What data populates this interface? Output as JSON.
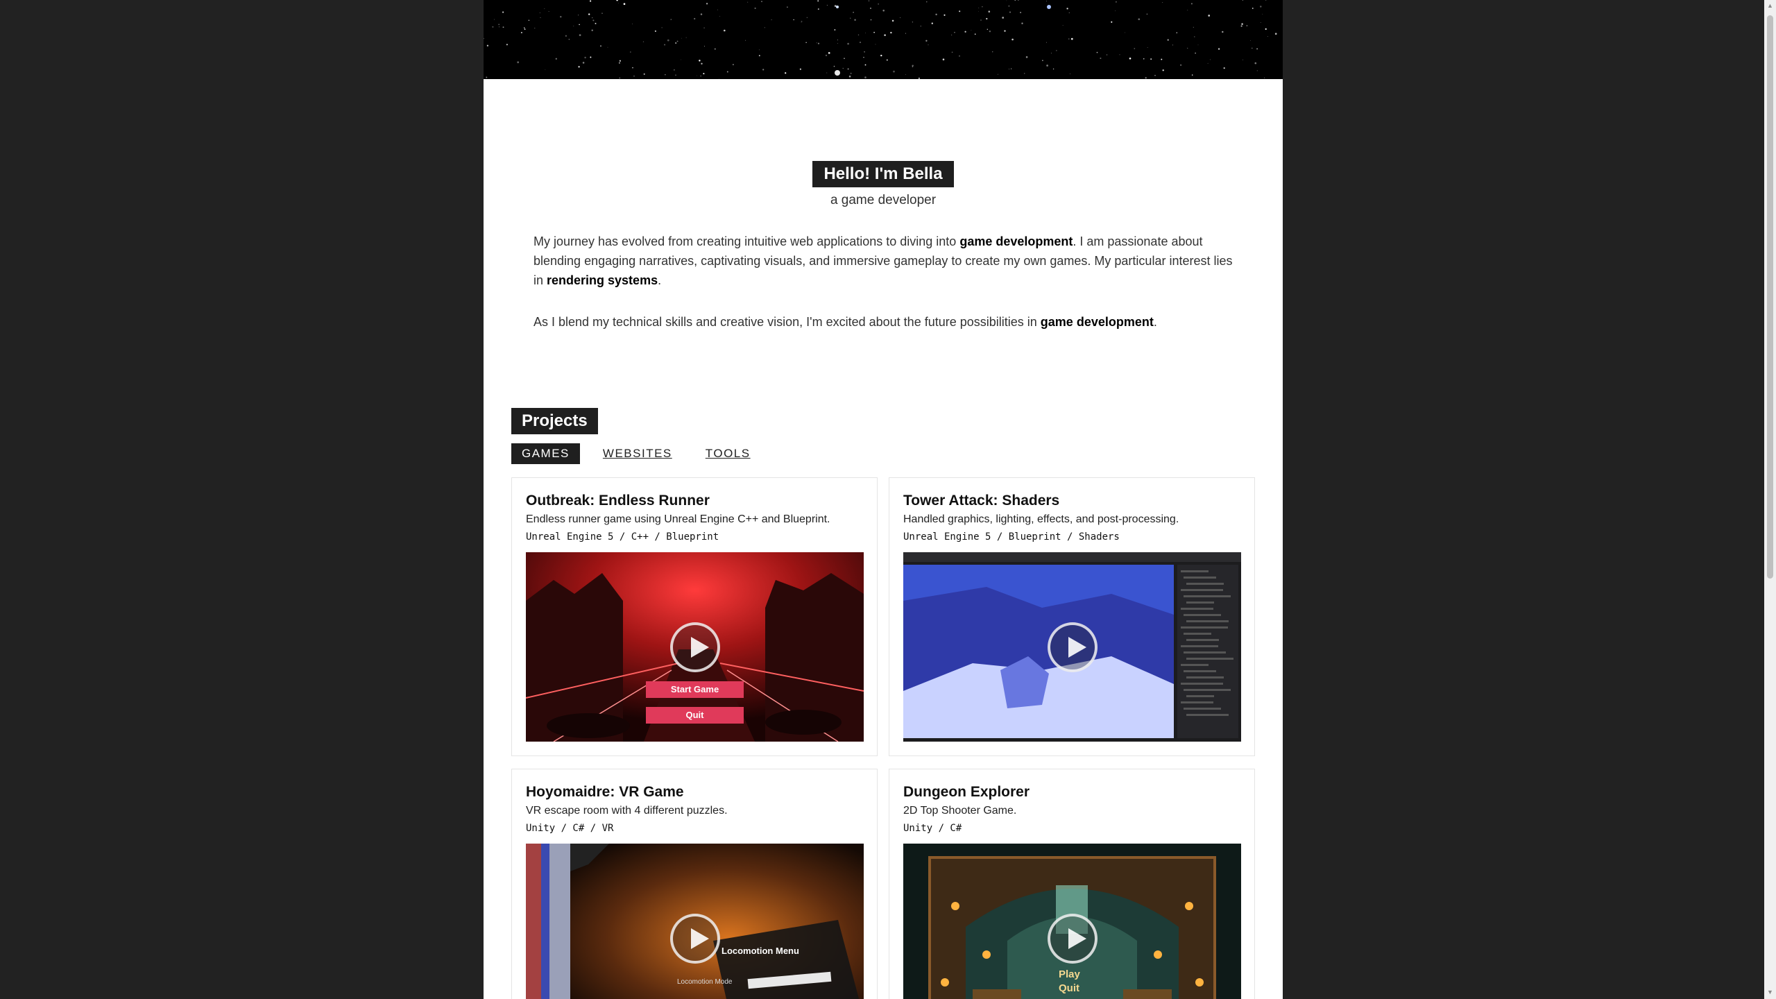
{
  "hero": {
    "title": "Hello! I'm Bella",
    "subtitle": "a game developer"
  },
  "about": {
    "p1_a": "My journey has evolved from creating intuitive web applications to diving into ",
    "p1_b": "game development",
    "p1_c": ". I am passionate about blending engaging narratives, captivating visuals, and immersive gameplay to create my own games. My particular interest lies in ",
    "p1_d": "rendering systems",
    "p1_e": ".",
    "p2_a": "As I blend my technical skills and creative vision, I'm excited about the future possibilities in ",
    "p2_b": "game development",
    "p2_c": "."
  },
  "projects": {
    "title": "Projects",
    "tabs": [
      "GAMES",
      "WEBSITES",
      "TOOLS"
    ],
    "active_tab": "GAMES",
    "cards": [
      {
        "title": "Outbreak: Endless Runner",
        "desc": "Endless runner game using Unreal Engine C++ and Blueprint.",
        "tags": "Unreal Engine 5 / C++ / Blueprint",
        "menu": [
          "Start Game",
          "Quit"
        ]
      },
      {
        "title": "Tower Attack: Shaders",
        "desc": "Handled graphics, lighting, effects, and post-processing.",
        "tags": "Unreal Engine 5 / Blueprint / Shaders"
      },
      {
        "title": "Hoyomaidre: VR Game",
        "desc": "VR escape room with 4 different puzzles.",
        "tags": "Unity / C# / VR",
        "overlay_title": "Locomotion Menu",
        "overlay_label": "Locomotion Mode"
      },
      {
        "title": "Dungeon Explorer",
        "desc": "2D Top Shooter Game.",
        "tags": "Unity / C#",
        "overlay_play": "Play",
        "overlay_quit": "Quit"
      }
    ]
  },
  "colors": {
    "page_bg": "#222222",
    "content_bg": "#ffffff",
    "label_bg": "#1f1f1f",
    "menu_button": "#e03a5a"
  }
}
